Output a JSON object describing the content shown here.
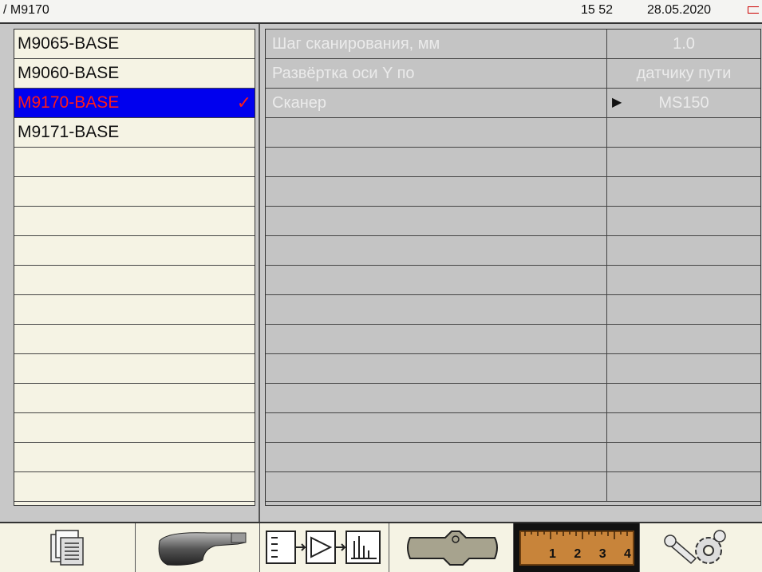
{
  "header": {
    "path": "/ M9170",
    "time": "15 52",
    "date": "28.05.2020"
  },
  "left_list": {
    "items": [
      {
        "label": "M9065-BASE",
        "selected": false
      },
      {
        "label": "M9060-BASE",
        "selected": false
      },
      {
        "label": "M9170-BASE",
        "selected": true
      },
      {
        "label": "M9171-BASE",
        "selected": false
      }
    ],
    "check_mark": "✓"
  },
  "settings": {
    "rows": [
      {
        "name": "Шаг сканирования, мм",
        "value": "1.0"
      },
      {
        "name": "Развёртка оси Y по",
        "value": "датчику пути"
      },
      {
        "name": "Сканер",
        "value": "MS150",
        "has_arrow": true
      }
    ],
    "arrow_glyph": "▶"
  },
  "toolbar": {
    "buttons": [
      {
        "name": "documents-button",
        "icon": "documents-icon"
      },
      {
        "name": "probe-button",
        "icon": "probe-icon"
      },
      {
        "name": "signal-chain-button",
        "icon": "signal-chain-icon"
      },
      {
        "name": "weld-button",
        "icon": "weld-icon"
      },
      {
        "name": "ruler-button",
        "icon": "ruler-icon",
        "active": true,
        "label": "1 2 3 4"
      },
      {
        "name": "settings-button",
        "icon": "wrench-gear-icon"
      }
    ]
  },
  "colors": {
    "selected_bg": "#0000ee",
    "selected_text": "#ff1a1a",
    "panel_bg": "#f5f3e4",
    "grid_bg": "#c4c4c4"
  }
}
